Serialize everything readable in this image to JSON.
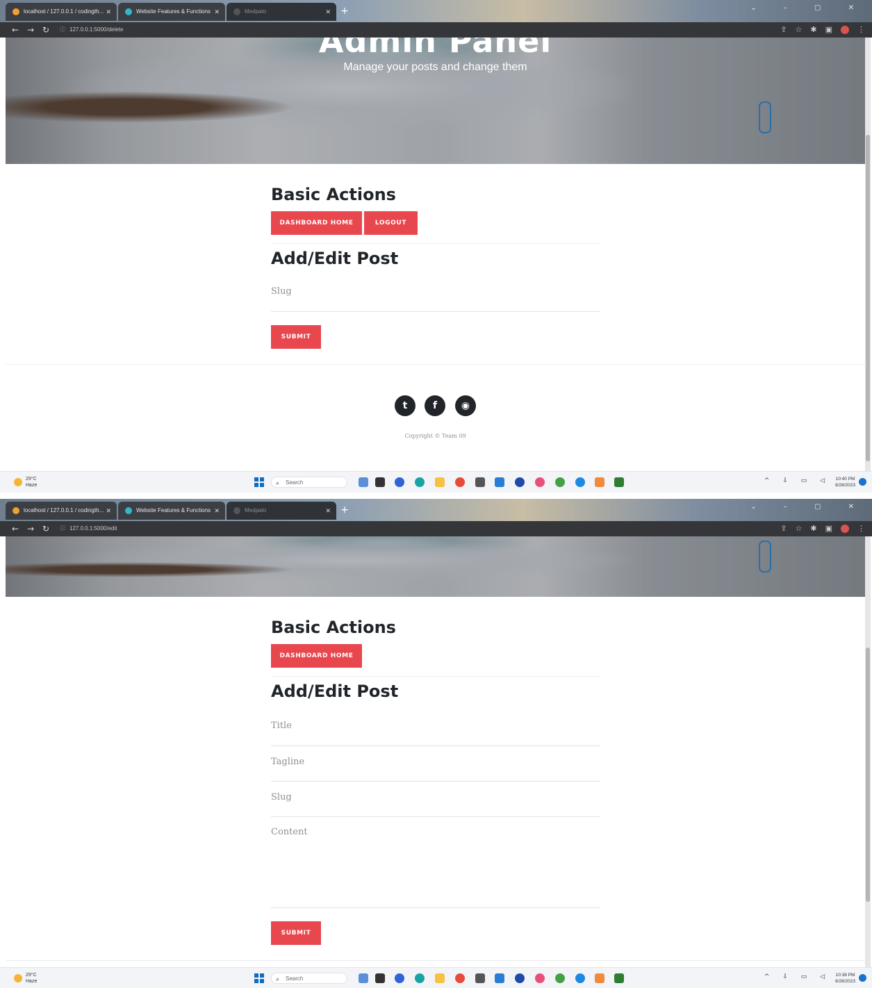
{
  "browser": {
    "tabs": [
      {
        "label": "localhost / 127.0.0.1 / codingth..."
      },
      {
        "label": "Website Features & Functions"
      },
      {
        "label": "Medpato"
      }
    ],
    "new_tab": "+",
    "win_controls": "⌄ – ▢ ✕"
  },
  "screens": [
    {
      "url": "127.0.0.1:5000/delete",
      "hero": {
        "title": "Admin Panel",
        "subtitle": "Manage your posts and change them"
      },
      "basic_actions": {
        "heading": "Basic Actions",
        "dashboard_label": "DASHBOARD HOME",
        "logout_label": "LOGOUT"
      },
      "form": {
        "heading": "Add/Edit Post",
        "slug_placeholder": "Slug",
        "submit_label": "SUBMIT"
      },
      "footer": {
        "copyright": "Copyright © Team 09"
      },
      "taskbar": {
        "temp": "29°C",
        "condition": "Haze",
        "search": "Search",
        "time": "10:40 PM",
        "date": "8/28/2023"
      }
    },
    {
      "url": "127.0.0.1:5000/edit",
      "basic_actions": {
        "heading": "Basic Actions",
        "dashboard_label": "DASHBOARD HOME"
      },
      "form": {
        "heading": "Add/Edit Post",
        "title_placeholder": "Title",
        "tagline_placeholder": "Tagline",
        "slug_placeholder": "Slug",
        "content_placeholder": "Content",
        "submit_label": "SUBMIT"
      },
      "taskbar": {
        "temp": "29°C",
        "condition": "Haze",
        "search": "Search",
        "time": "10:38 PM",
        "date": "8/28/2023"
      }
    }
  ],
  "colors": {
    "accent": "#e8474d",
    "dark": "#212529"
  }
}
